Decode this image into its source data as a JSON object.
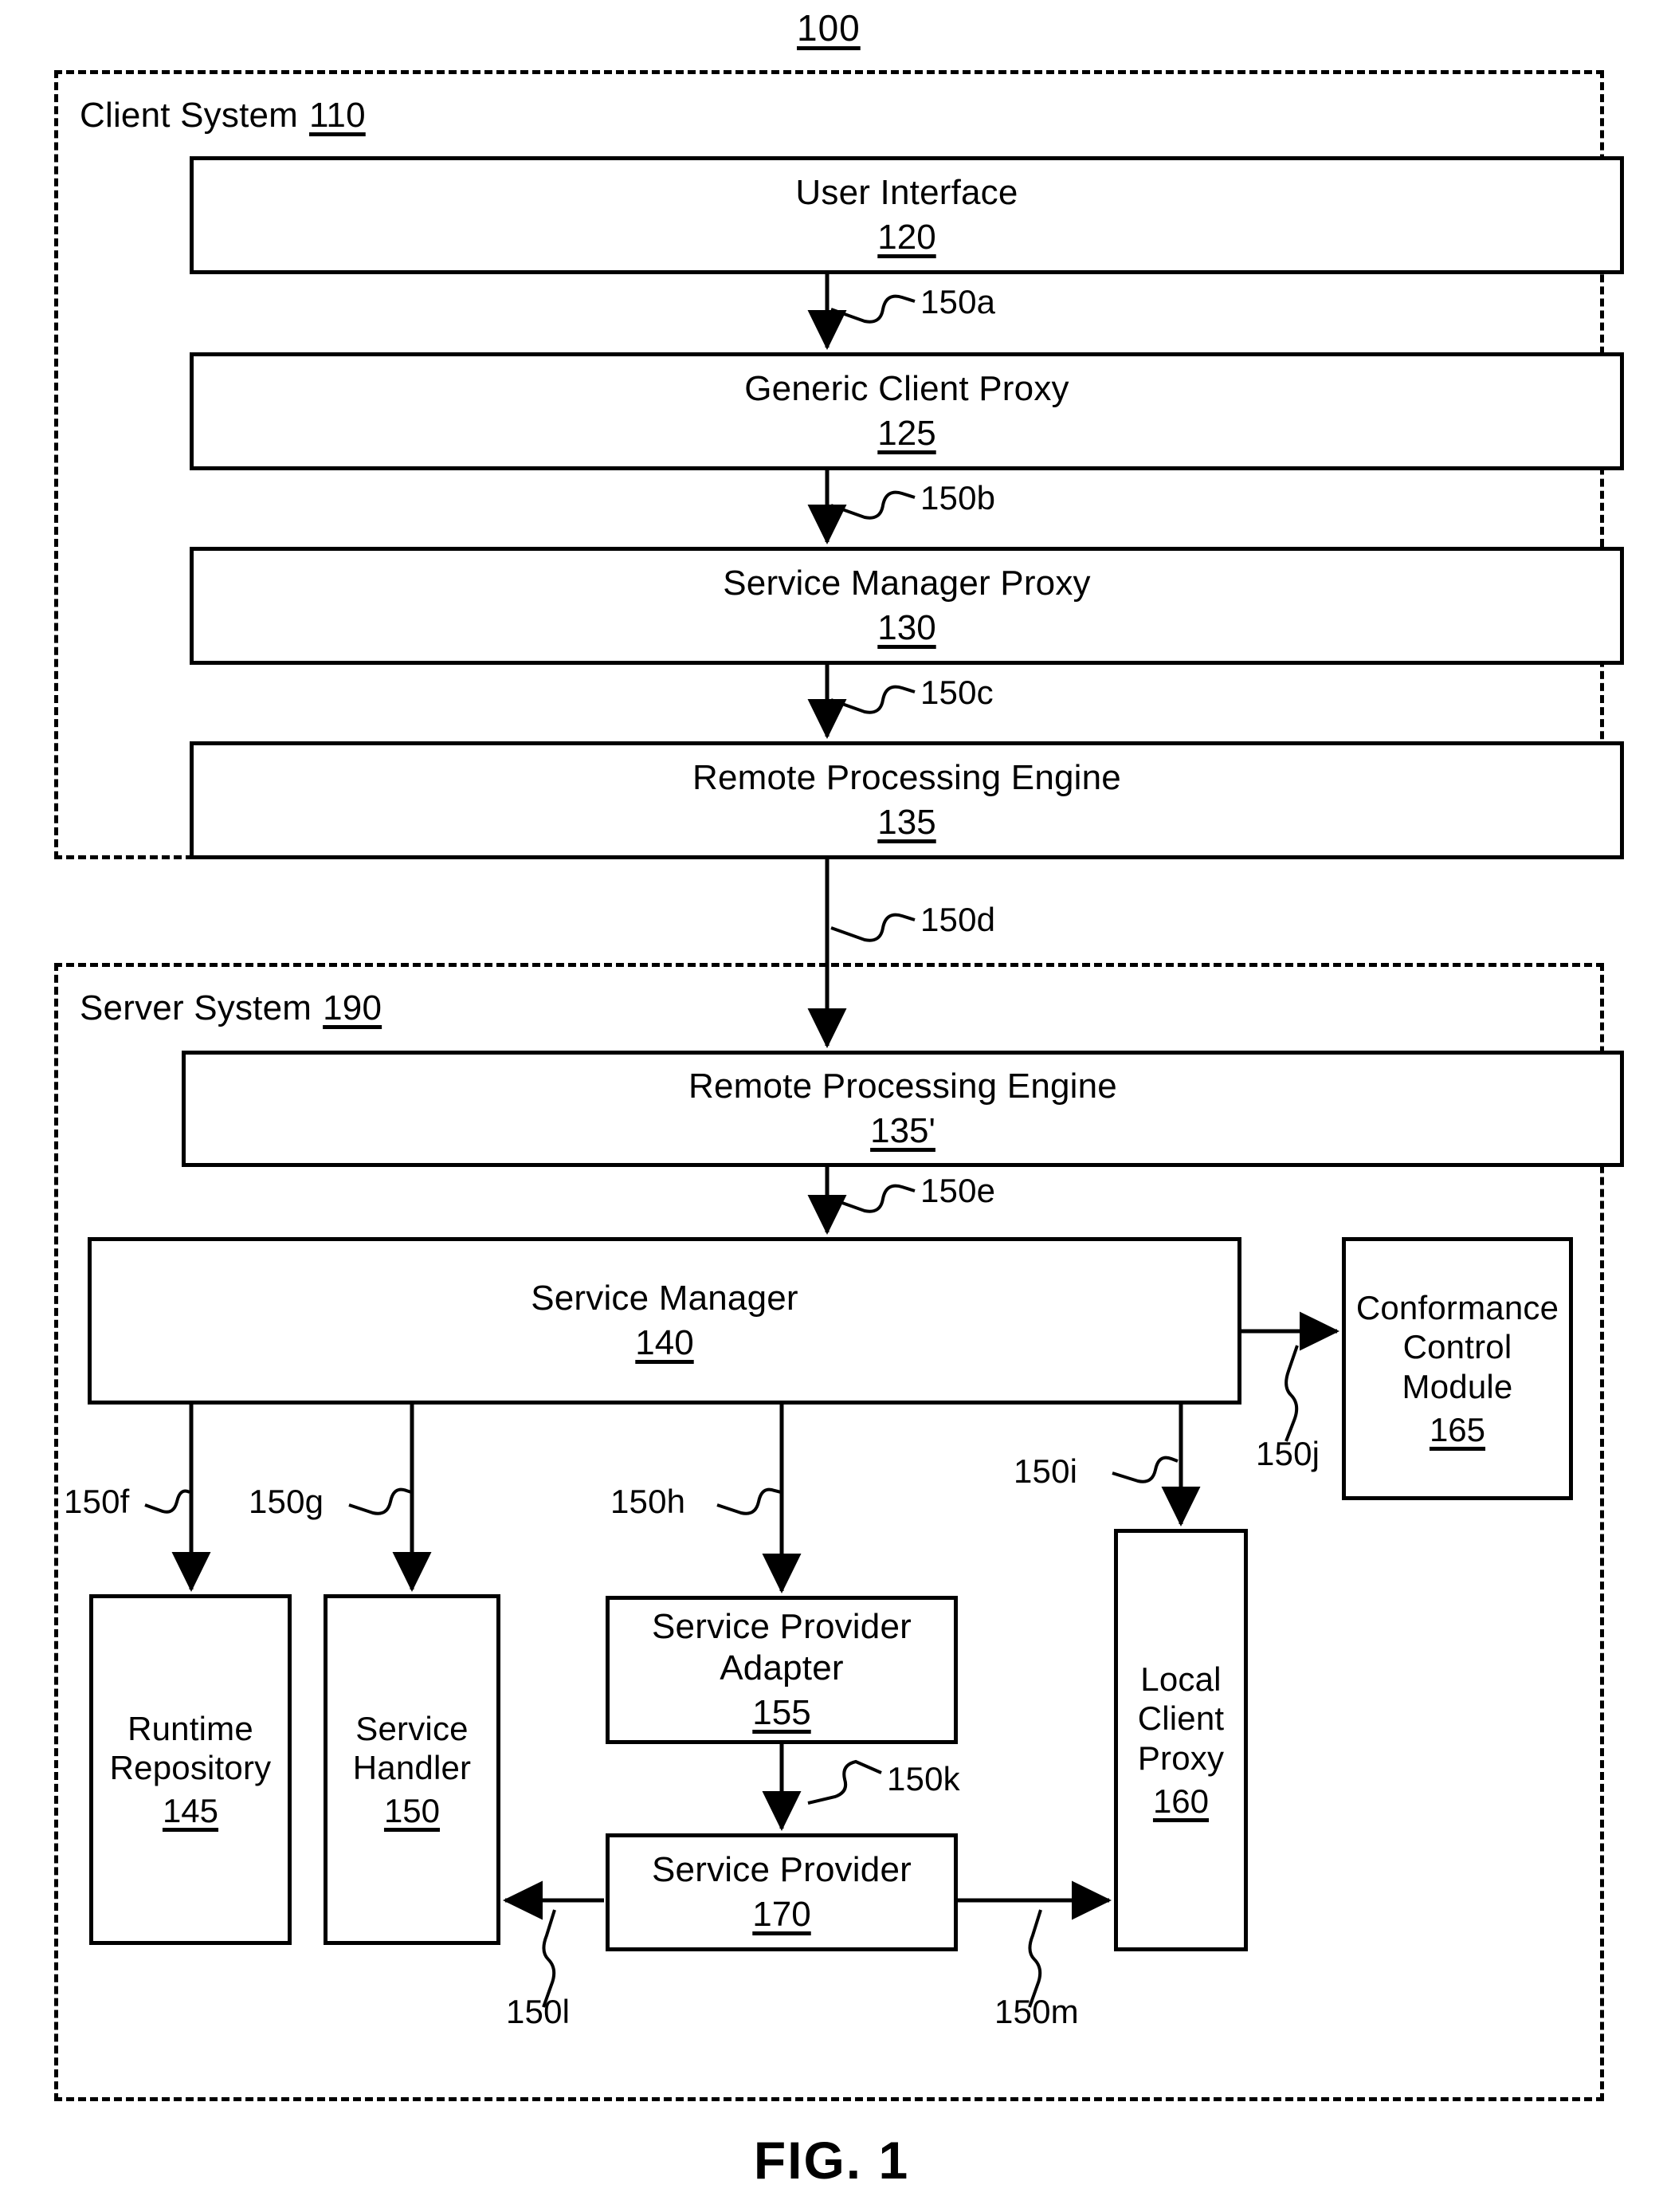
{
  "figure": {
    "reference_number": "100",
    "caption": "FIG. 1"
  },
  "systems": [
    {
      "key": "client",
      "title": "Client System",
      "number": "110"
    },
    {
      "key": "server",
      "title": "Server System",
      "number": "190"
    }
  ],
  "client_components": [
    {
      "label": "User Interface",
      "number": "120"
    },
    {
      "label": "Generic Client Proxy",
      "number": "125"
    },
    {
      "label": "Service Manager Proxy",
      "number": "130"
    },
    {
      "label": "Remote Processing Engine",
      "number": "135"
    }
  ],
  "server_components": [
    {
      "label": "Remote Processing Engine",
      "number": "135'"
    },
    {
      "label": "Service Manager",
      "number": "140"
    },
    {
      "label": "Conformance\nControl\nModule",
      "number": "165"
    },
    {
      "label": "Runtime\nRepository",
      "number": "145"
    },
    {
      "label": "Service\nHandler",
      "number": "150"
    },
    {
      "label": "Service Provider\nAdapter",
      "number": "155"
    },
    {
      "label": "Local\nClient\nProxy",
      "number": "160"
    },
    {
      "label": "Service Provider",
      "number": "170"
    }
  ],
  "connectors": [
    {
      "id": "150a",
      "label": "150a",
      "from": "User Interface 120",
      "to": "Generic Client Proxy 125"
    },
    {
      "id": "150b",
      "label": "150b",
      "from": "Generic Client Proxy 125",
      "to": "Service Manager Proxy 130"
    },
    {
      "id": "150c",
      "label": "150c",
      "from": "Service Manager Proxy 130",
      "to": "Remote Processing Engine 135"
    },
    {
      "id": "150d",
      "label": "150d",
      "from": "Remote Processing Engine 135",
      "to": "Remote Processing Engine 135'"
    },
    {
      "id": "150e",
      "label": "150e",
      "from": "Remote Processing Engine 135'",
      "to": "Service Manager 140"
    },
    {
      "id": "150f",
      "label": "150f",
      "from": "Service Manager 140",
      "to": "Runtime Repository 145"
    },
    {
      "id": "150g",
      "label": "150g",
      "from": "Service Manager 140",
      "to": "Service Handler 150"
    },
    {
      "id": "150h",
      "label": "150h",
      "from": "Service Manager 140",
      "to": "Service Provider Adapter 155"
    },
    {
      "id": "150i",
      "label": "150i",
      "from": "Service Manager 140",
      "to": "Local Client Proxy 160"
    },
    {
      "id": "150j",
      "label": "150j",
      "from": "Service Manager 140",
      "to": "Conformance Control Module 165"
    },
    {
      "id": "150k",
      "label": "150k",
      "from": "Service Provider Adapter 155",
      "to": "Service Provider 170"
    },
    {
      "id": "150l",
      "label": "150l",
      "from": "Service Provider 170",
      "to": "Service Handler 150"
    },
    {
      "id": "150m",
      "label": "150m",
      "from": "Service Provider 170",
      "to": "Local Client Proxy 160"
    }
  ],
  "colors": {
    "ink": "#000000",
    "paper": "#ffffff"
  }
}
